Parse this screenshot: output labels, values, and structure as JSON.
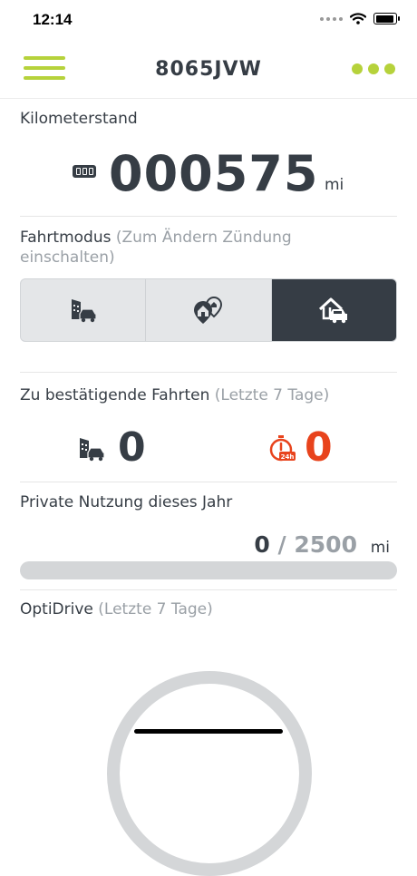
{
  "status_bar": {
    "time": "12:14"
  },
  "header": {
    "title": "8065JVW",
    "menu_icon": "hamburger-menu-icon",
    "more_icon": "more-dots-icon",
    "accent": "#b6d23b"
  },
  "odometer": {
    "label": "Kilometerstand",
    "value": "000575",
    "unit": "mi"
  },
  "drive_mode": {
    "label": "Fahrtmodus",
    "hint": "(Zum Ändern Zündung einschalten)",
    "options": [
      {
        "name": "business",
        "icon": "building-car-icon",
        "active": false
      },
      {
        "name": "commute",
        "icon": "location-home-icon",
        "active": false
      },
      {
        "name": "private",
        "icon": "home-car-icon",
        "active": true
      }
    ]
  },
  "trips_to_confirm": {
    "label": "Zu bestätigende Fahrten",
    "hint": "(Letzte 7 Tage)",
    "business_count": "0",
    "overdue_count": "0",
    "overdue_badge": "24h",
    "overdue_color": "#e8431c"
  },
  "private_usage": {
    "label": "Private Nutzung dieses Jahr",
    "used": "0",
    "separator": "/",
    "limit": "2500",
    "unit": "mi",
    "progress_fraction": 0
  },
  "optidrive": {
    "label": "OptiDrive",
    "hint": "(Letzte 7 Tage)"
  }
}
